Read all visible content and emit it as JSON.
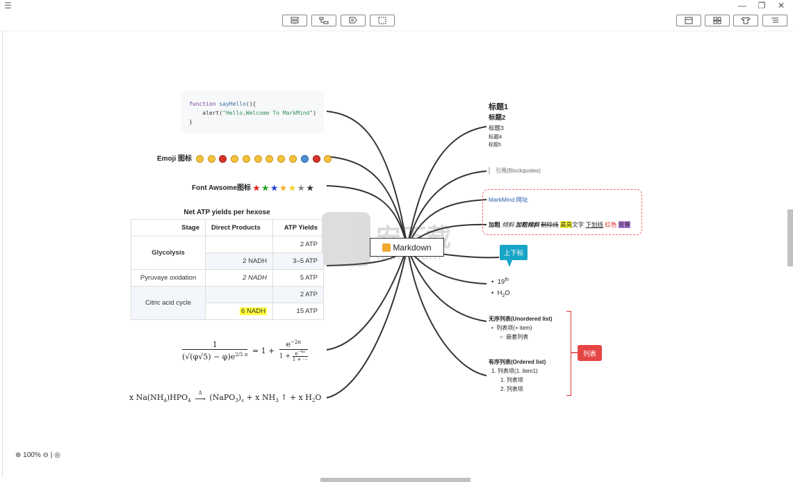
{
  "titlebar": {
    "menu_icon": "☰",
    "minimize": "—",
    "restore": "❐",
    "close": "✕"
  },
  "toolbar": {
    "left_buttons": [
      "insert-sibling-icon",
      "insert-child-icon",
      "insert-note-icon",
      "select-icon"
    ],
    "right_buttons": [
      "layout-icon",
      "theme-icon",
      "style-icon",
      "outline-icon"
    ]
  },
  "code_block": {
    "line1_kw": "function",
    "line1_fn": "sayHello",
    "line1_rest": "(){",
    "line2_pre": "    alert(",
    "line2_str": "\"Hello,Welcome To MarkMind\"",
    "line2_end": ")",
    "line3": "}"
  },
  "emoji_label": "Emoji 图标",
  "font_awesome_label": "Font Awsome图标",
  "star_colors": [
    "#e02020",
    "#20a020",
    "#2040d0",
    "#f0b020",
    "#f0d020",
    "#888888",
    "#333333"
  ],
  "table": {
    "title": "Net ATP yields per hexose",
    "headers": [
      "Stage",
      "Direct Products",
      "ATP Yields"
    ],
    "rows": [
      {
        "stage": "Glycolysis",
        "direct": "",
        "atp": "2 ATP"
      },
      {
        "direct": "2 NADH",
        "atp": "3–5 ATP"
      },
      {
        "stage": "Pyruvaye oxidation",
        "direct": "2 NADH",
        "atp": "5 ATP"
      },
      {
        "stage": "Citric acid cycle",
        "direct": "",
        "atp": "2 ATP"
      },
      {
        "direct": "6 NADH",
        "atp": "15 ATP"
      }
    ]
  },
  "math": {
    "formula1_num": "1",
    "formula1_den": "(√(φ√5) − φ)e",
    "formula1_den_exp": "2/5 π",
    "formula1_eq": "= 1 +",
    "formula1_cf_num": "e",
    "formula1_cf_num_exp": "−2π",
    "formula1_cf_den": "1 +",
    "formula1_cf_den2": "e",
    "formula1_cf_den2_exp": "−4π",
    "formula1_cf_den3": "1 + ⋯",
    "formula2_a": "x Na(NH",
    "formula2_a_sub": "4",
    "formula2_b": ")HPO",
    "formula2_b_sub": "4",
    "formula2_arrow": "Δ",
    "formula2_c": " (NaPO",
    "formula2_c_sub": "3",
    "formula2_c2": ")",
    "formula2_c2_sub": "x",
    "formula2_d": " + x NH",
    "formula2_d_sub": "3",
    "formula2_e": " ↑ + x H",
    "formula2_e_sub": "2",
    "formula2_f": "O"
  },
  "root": {
    "label": "Markdown"
  },
  "headings": [
    "标题1",
    "标题2",
    "标题3",
    "标题4",
    "标题5"
  ],
  "blockquote": "引用(Blockquotes)",
  "link": "MarkMind 网址",
  "formatting": {
    "bold": "加粗",
    "italic": "倾斜",
    "bold_italic": "加粗倾斜",
    "strike": "删除线",
    "highlight": "高亮",
    "text": "文字",
    "underline": "下划线",
    "red": "红色",
    "bg": "背景"
  },
  "callout": "上下标",
  "supsub": {
    "sup_base": "19",
    "sup": "th",
    "sub_a": "H",
    "sub": "2",
    "sub_b": "O"
  },
  "unordered": {
    "title": "无序列表(Unordered list)",
    "item": "列表项(+ item)",
    "nested": "嵌套列表"
  },
  "ordered": {
    "title": "有序列表(Ordered list)",
    "item": "列表项(1. item1)",
    "sub1": "列表项",
    "sub2": "列表项"
  },
  "list_tag": "列表",
  "zoom": {
    "level": "100%",
    "zoom_in_icon": "⊕",
    "zoom_out_icon": "⊖",
    "sep": "|",
    "fit_icon": "◎"
  },
  "watermark": {
    "text": "安下载",
    "url": "anxz.com"
  }
}
